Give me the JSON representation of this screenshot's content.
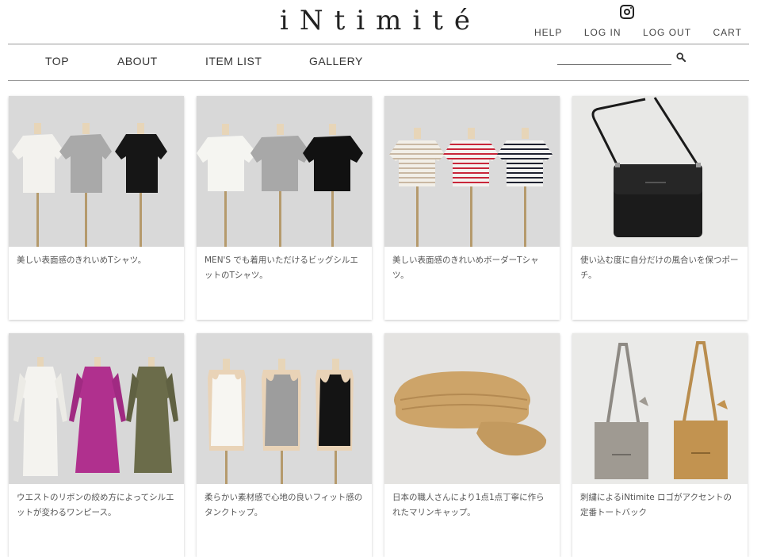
{
  "header": {
    "logo": "iNtimité",
    "top_links": [
      "HELP",
      "LOG IN",
      "LOG OUT",
      "CART"
    ],
    "instagram_icon": "instagram-icon"
  },
  "nav": {
    "items": [
      "TOP",
      "ABOUT",
      "ITEM LIST",
      "GALLERY"
    ],
    "search_placeholder": ""
  },
  "products": [
    {
      "desc": "美しい表面感のきれいめTシャツ。",
      "image": "three-tshirts-white-gray-black"
    },
    {
      "desc": "MEN'S でも着用いただけるビッグシルエットのTシャツ。",
      "image": "three-big-tshirts-white-gray-black"
    },
    {
      "desc": "美しい表面感のきれいめボーダーTシャツ。",
      "image": "three-striped-tshirts"
    },
    {
      "desc": "使い込む度に自分だけの風合いを保つポーチ。",
      "image": "black-leather-pouch"
    },
    {
      "desc": "ウエストのリボンの絞め方によってシルエットが変わるワンピース。",
      "image": "three-gathered-dresses"
    },
    {
      "desc": "柔らかい素材感で心地の良いフィット感のタンクトップ。",
      "image": "three-tank-tops"
    },
    {
      "desc": "日本の職人さんにより1点1点丁寧に作られたマリンキャップ。",
      "image": "straw-marine-cap"
    },
    {
      "desc": "刺繍によるiNtimite ロゴがアクセントの定番トートバック",
      "image": "two-tote-bags"
    }
  ],
  "colors": {
    "text": "#333333",
    "rule": "#999999",
    "photo_bg": "#dcdcdc"
  }
}
